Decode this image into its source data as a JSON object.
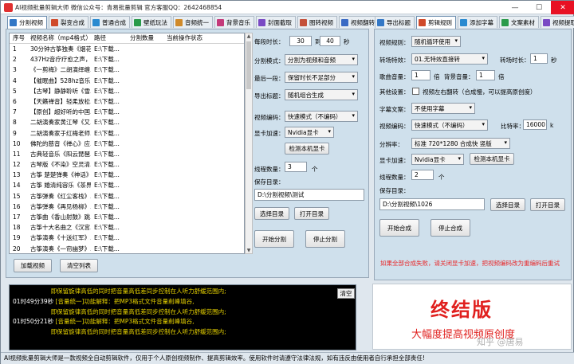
{
  "window": {
    "title": "AI视频批量剪辑大师  微信公众号：青易批量剪辑  官方客服QQ：2642468854",
    "minimize": "—",
    "maximize": "☐",
    "close": "✕"
  },
  "left_tabs": [
    {
      "label": "分割视频",
      "color": "#3478c6"
    },
    {
      "label": "裂变合成",
      "color": "#d04a2a"
    },
    {
      "label": "普通合成",
      "color": "#2a8ad0"
    },
    {
      "label": "壁纸玩法",
      "color": "#2a9a4a"
    },
    {
      "label": "音频统一",
      "color": "#d08a2a"
    },
    {
      "label": "背景音乐",
      "color": "#c43a7a"
    },
    {
      "label": "封面截取",
      "color": "#7a4ac4"
    },
    {
      "label": "图转视频",
      "color": "#c4503a"
    },
    {
      "label": "视频翻转",
      "color": "#3a6ac4"
    }
  ],
  "right_tabs": [
    {
      "label": "导出标题",
      "color": "#3478c6"
    },
    {
      "label": "剪辑规则",
      "color": "#d04a2a"
    },
    {
      "label": "添加字幕",
      "color": "#2a8ad0"
    },
    {
      "label": "文案素材",
      "color": "#2a9a4a"
    },
    {
      "label": "视频提取",
      "color": "#7a4ac4"
    }
  ],
  "video_table": {
    "headers": [
      "序号",
      "视频名称（mp4格式）",
      "路径",
      "分割数量",
      "当前操作状态"
    ],
    "rows": [
      [
        "1",
        "30分钟古筝独奏《烟花...",
        "E:\\下载..."
      ],
      [
        "2",
        "437Hz音疗疗愈之声，...",
        "E:\\下载..."
      ],
      [
        "3",
        "《一剪梅》二胡演绎缠...",
        "E:\\下载..."
      ],
      [
        "4",
        "【催眠曲】528hz音乐 ...",
        "E:\\下载..."
      ],
      [
        "5",
        "【古琴】静静聆听《雪...",
        "E:\\下载..."
      ],
      [
        "6",
        "【天籁禅音】轻柔放松...",
        "E:\\下载..."
      ],
      [
        "7",
        "【原创】超好听的中国...",
        "E:\\下载..."
      ],
      [
        "8",
        "二胡演奏家黄江琴《又...",
        "E:\\下载..."
      ],
      [
        "9",
        "二胡演奏家于红梅老师...",
        "E:\\下载..."
      ],
      [
        "10",
        "佛陀的慈音《禅心》应...",
        "E:\\下载..."
      ],
      [
        "11",
        "古典轻音乐《阳云琵琶...",
        "E:\\下载..."
      ],
      [
        "12",
        "古琴版《不染》空灵清...",
        "E:\\下载..."
      ],
      [
        "13",
        "古筝 楚楚弹奏《神话》...",
        "E:\\下载..."
      ],
      [
        "14",
        "古筝 婚清纯容乐《茶界...",
        "E:\\下载..."
      ],
      [
        "15",
        "古筝弹奏《红尘客栈》...",
        "E:\\下载..."
      ],
      [
        "16",
        "古筝弹奏《再见杨柳》...",
        "E:\\下载..."
      ],
      [
        "17",
        "古筝曲《香山射鼓》跳...",
        "E:\\下载..."
      ],
      [
        "18",
        "古筝十大名曲之《汉宫...",
        "E:\\下载..."
      ],
      [
        "19",
        "古筝演奏《十送红军》...",
        "E:\\下载..."
      ],
      [
        "20",
        "古筝演奏《一帘幽梦》...",
        "E:\\下载..."
      ]
    ]
  },
  "left_buttons": {
    "load": "加载视频",
    "clear": "清空列表"
  },
  "split": {
    "duration_label": "每段时长：",
    "duration_from": "30",
    "to_label": "到",
    "duration_to": "40",
    "unit_sec": "秒",
    "mode_label": "分割模式：",
    "mode_value": "分割为视频和音频",
    "last_label": "最后一段：",
    "last_value": "保留时长不足部分",
    "export_label": "导出标题：",
    "export_value": "随机组合生成",
    "encode_label": "视频编码：",
    "encode_value": "快速模式（不编码）",
    "gpu_label": "显卡加速：",
    "gpu_value": "Nvidia显卡",
    "detect_gpu": "检测本机显卡",
    "threads_label": "线程数量：",
    "threads_value": "3",
    "threads_unit": "个",
    "save_label": "保存目录：",
    "save_value": "D:\\分割视频\\测试",
    "choose_dir": "选择目录",
    "open_dir": "打开目录",
    "start": "开始分割",
    "stop": "停止分割"
  },
  "rules": {
    "rule_label": "视频规则：",
    "rule_value": "随机循环使用",
    "transition_label": "转场特效：",
    "transition_value": "01.无特效直接转",
    "transition_dur_label": "转场时长：",
    "transition_dur_value": "1",
    "unit_sec": "秒",
    "music_vol_label": "歌曲音量：",
    "music_vol_value": "1",
    "times": "倍",
    "bg_vol_label": "背景音量：",
    "bg_vol_value": "1",
    "other_label": "其他设置：",
    "other_value": "视频左右翻转（合成慢，可以提高原创度）",
    "subtitle_label": "字幕文案：",
    "subtitle_value": "不使用字幕",
    "encode_label": "视频编码：",
    "encode_value": "快速模式（不编码）",
    "bitrate_label": "比特率：",
    "bitrate_value": "16000",
    "bitrate_unit": "k",
    "res_label": "分辨率：",
    "res_value": "标准 720*1280 合成快 竖版",
    "gpu_label": "显卡加速：",
    "gpu_value": "Nvidia显卡",
    "detect_gpu": "检测本机显卡",
    "threads_label": "线程数量：",
    "threads_value": "2",
    "threads_unit": "个",
    "save_label": "保存目录：",
    "save_value": "D:\\分割视频\\1026",
    "choose_dir": "选择目录",
    "open_dir": "打开目录",
    "start": "开始合成",
    "stop": "停止合成",
    "notice": "如果全部合成失败，请关闭显卡加速，把视频编码改为重编码后重试",
    "notice_color": "#e8282a"
  },
  "log": {
    "clear": "清空",
    "lines": [
      {
        "ts": "",
        "text": "即保留旋律高低的同时把音量高低差同步控制在人听力舒缓范围内;"
      },
      {
        "ts": "01时49分39秒",
        "text": "[音量统一]功能解释：把MP3格式文件音量削峰填谷,"
      },
      {
        "ts": "",
        "text": "即保留旋律高低的同时把音量高低差同步控制在人听力舒缓范围内;"
      },
      {
        "ts": "01时50分21秒",
        "text": "[音量统一]功能解释：把MP3格式文件音量削峰填谷,"
      },
      {
        "ts": "",
        "text": "即保留旋律高低的同时把音量高低差同步控制在人听力舒缓范围内;"
      }
    ]
  },
  "promo": {
    "title": "终结版",
    "subtitle": "大幅度提高视频原创度",
    "watermark": "知乎 @唐易",
    "title_color": "#e0201e"
  },
  "status": "AI视频批量剪辑大师是一款视频全自动剪辑软件，仅用于个人原创视频制作、提高剪辑效率。使用软件时请遵守法律法规，如有违反由使用者自行承担全部责任!"
}
